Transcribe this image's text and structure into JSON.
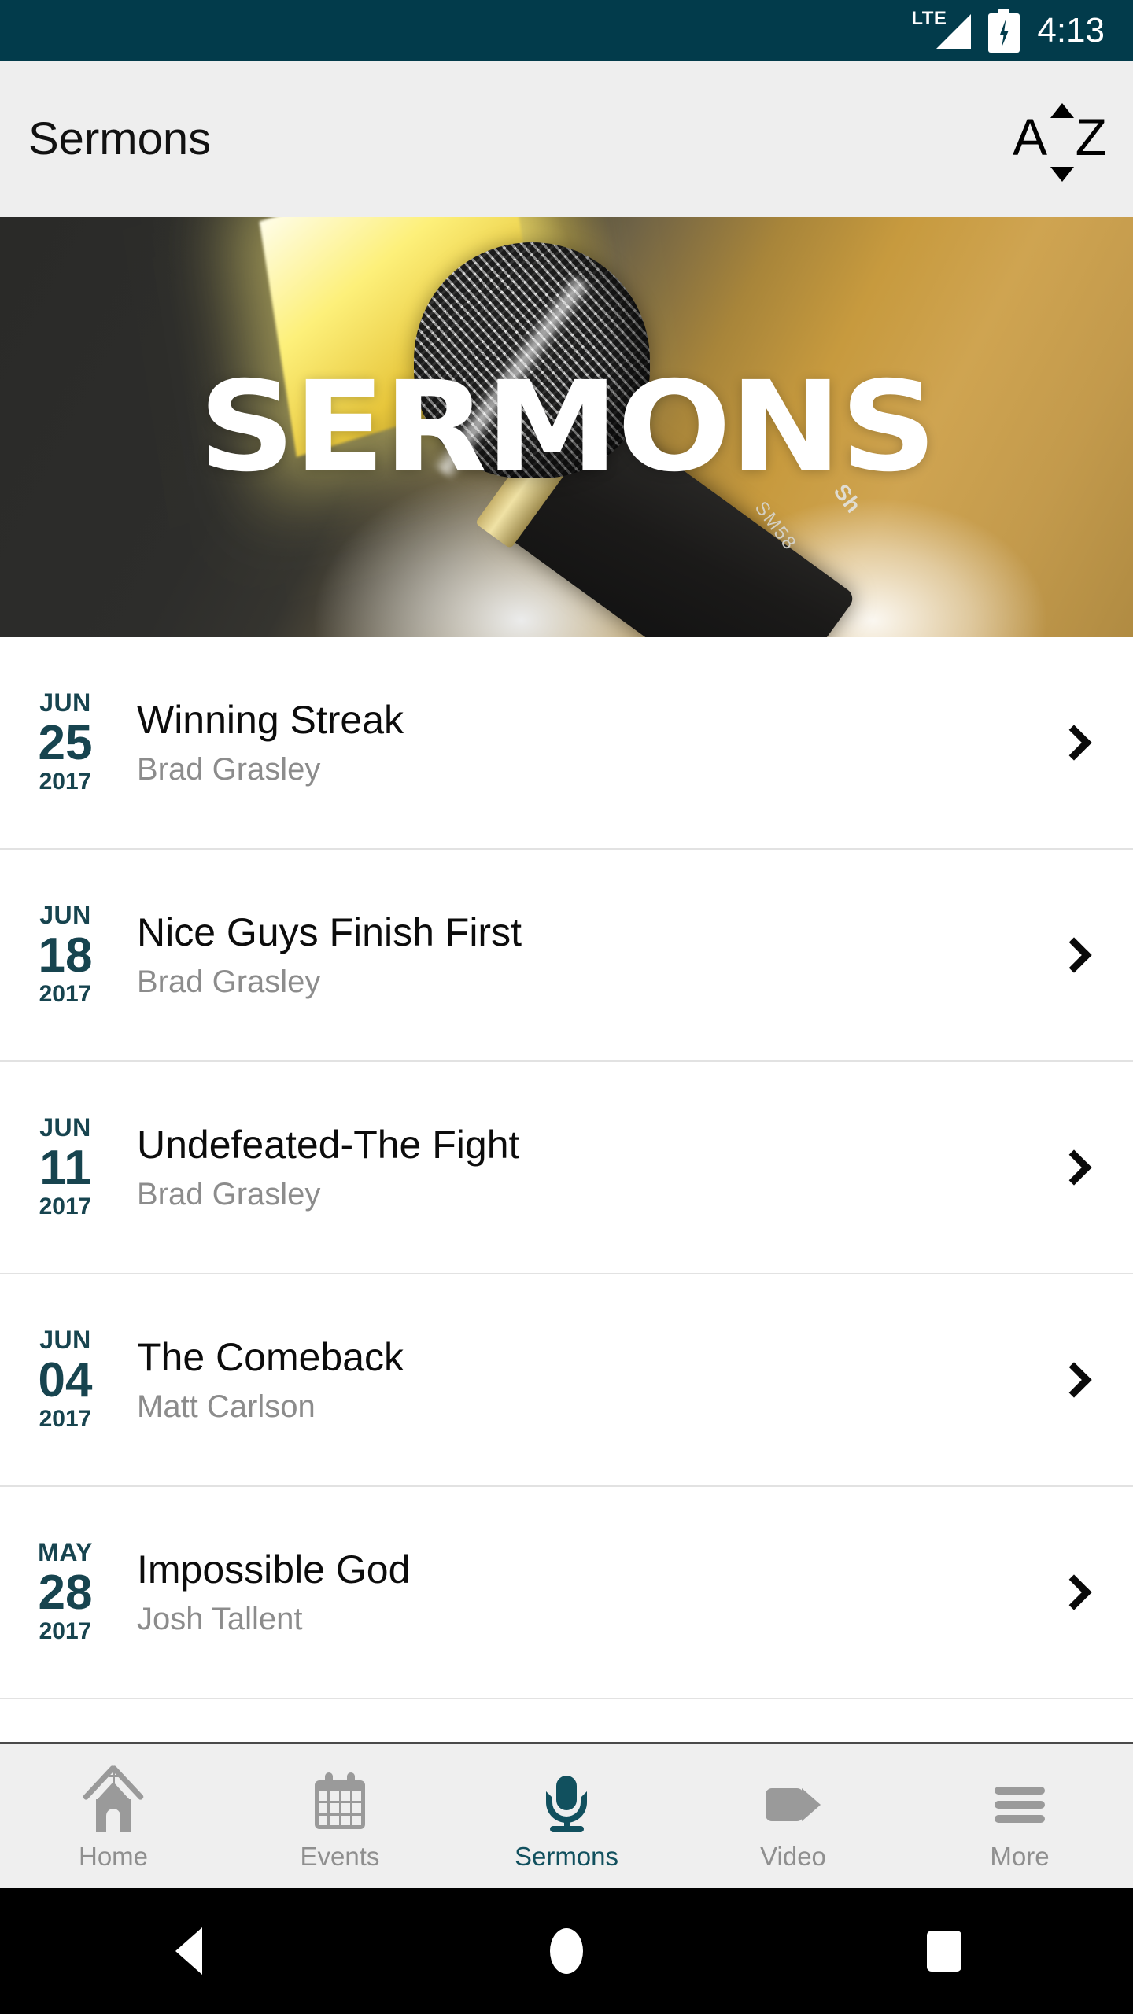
{
  "status_bar": {
    "network": "LTE",
    "time": "4:13",
    "signal_icon": "signal-triangle-icon",
    "battery_icon": "battery-charging-icon",
    "background_color": "#023B4B"
  },
  "app_bar": {
    "title": "Sermons",
    "background_color": "#EEEEEE",
    "sort_button": {
      "name": "sort-az-button",
      "letter_start": "A",
      "letter_end": "Z",
      "icon": "sort-alpha-icon"
    }
  },
  "hero": {
    "headline": "SERMONS",
    "mic_model": "SM58",
    "mic_brand": "Sh",
    "image_alt": "Shure SM58 microphone lit by a warm yellow light"
  },
  "sermons": [
    {
      "month": "JUN",
      "day": "25",
      "year": "2017",
      "title": "Winning Streak",
      "speaker": "Brad Grasley",
      "chevron": "chevron-right-icon"
    },
    {
      "month": "JUN",
      "day": "18",
      "year": "2017",
      "title": "Nice Guys Finish First",
      "speaker": "Brad Grasley",
      "chevron": "chevron-right-icon"
    },
    {
      "month": "JUN",
      "day": "11",
      "year": "2017",
      "title": "Undefeated-The Fight",
      "speaker": "Brad Grasley",
      "chevron": "chevron-right-icon"
    },
    {
      "month": "JUN",
      "day": "04",
      "year": "2017",
      "title": "The Comeback",
      "speaker": "Matt Carlson",
      "chevron": "chevron-right-icon"
    },
    {
      "month": "MAY",
      "day": "28",
      "year": "2017",
      "title": "Impossible God",
      "speaker": "Josh Tallent",
      "chevron": "chevron-right-icon"
    }
  ],
  "tab_bar": {
    "active_color": "#11505E",
    "inactive_color": "#8F8F8F",
    "background_color": "#EFEFEF",
    "tabs": [
      {
        "label": "Home",
        "icon": "church-icon",
        "active": false
      },
      {
        "label": "Events",
        "icon": "calendar-icon",
        "active": false
      },
      {
        "label": "Sermons",
        "icon": "microphone-icon",
        "active": true
      },
      {
        "label": "Video",
        "icon": "video-camera-icon",
        "active": false
      },
      {
        "label": "More",
        "icon": "hamburger-icon",
        "active": false
      }
    ]
  },
  "nav_bar": {
    "back": "back-triangle-icon",
    "home": "home-circle-icon",
    "recents": "recents-square-icon"
  }
}
